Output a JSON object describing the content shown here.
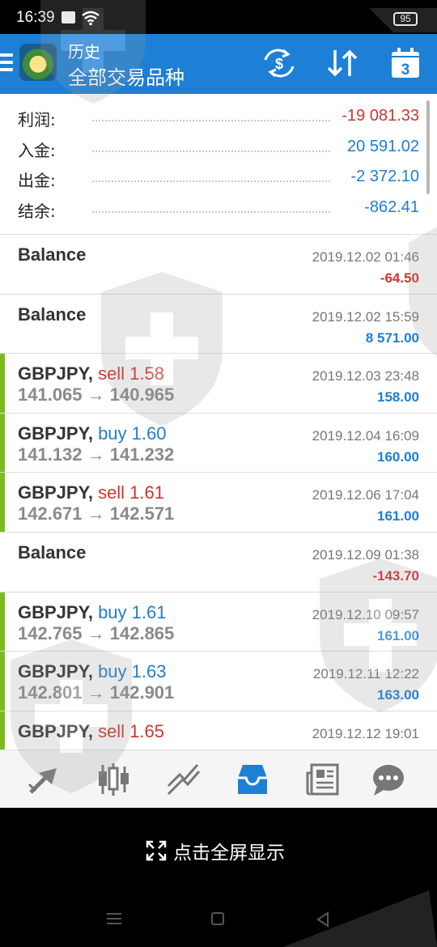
{
  "status_bar": {
    "time": "16:39",
    "battery": "95"
  },
  "header": {
    "subtitle": "历史",
    "title": "全部交易品种"
  },
  "header_icons": [
    "exchange-icon",
    "sort-icon",
    "calendar-icon"
  ],
  "calendar_day": "3",
  "summary": [
    {
      "label": "利润:",
      "value": "-19 081.33",
      "color": "red"
    },
    {
      "label": "入金:",
      "value": "20 591.02",
      "color": "blue"
    },
    {
      "label": "出金:",
      "value": "-2 372.10",
      "color": "blue"
    },
    {
      "label": "结余:",
      "value": "-862.41",
      "color": "blue"
    }
  ],
  "deals": [
    {
      "type": "balance",
      "symbol": "Balance",
      "date": "2019.12.02 01:46",
      "profit": "-64.50",
      "profit_color": "red"
    },
    {
      "type": "balance",
      "symbol": "Balance",
      "date": "2019.12.02 15:59",
      "profit": "8 571.00",
      "profit_color": "blue"
    },
    {
      "type": "trade",
      "symbol": "GBPJPY,",
      "side": "sell 1.58",
      "side_color": "red",
      "prices": "141.065 → 140.965",
      "date": "2019.12.03 23:48",
      "profit": "158.00",
      "profit_color": "blue"
    },
    {
      "type": "trade",
      "symbol": "GBPJPY,",
      "side": "buy 1.60",
      "side_color": "blue",
      "prices": "141.132 → 141.232",
      "date": "2019.12.04 16:09",
      "profit": "160.00",
      "profit_color": "blue"
    },
    {
      "type": "trade",
      "symbol": "GBPJPY,",
      "side": "sell 1.61",
      "side_color": "red",
      "prices": "142.671 → 142.571",
      "date": "2019.12.06 17:04",
      "profit": "161.00",
      "profit_color": "blue"
    },
    {
      "type": "balance",
      "symbol": "Balance",
      "date": "2019.12.09 01:38",
      "profit": "-143.70",
      "profit_color": "red"
    },
    {
      "type": "trade",
      "symbol": "GBPJPY,",
      "side": "buy 1.61",
      "side_color": "blue",
      "prices": "142.765 → 142.865",
      "date": "2019.12.10 09:57",
      "profit": "161.00",
      "profit_color": "blue"
    },
    {
      "type": "trade",
      "symbol": "GBPJPY,",
      "side": "buy 1.63",
      "side_color": "blue",
      "prices": "142.801 → 142.901",
      "date": "2019.12.11 12:22",
      "profit": "163.00",
      "profit_color": "blue"
    },
    {
      "type": "trade",
      "symbol": "GBPJPY,",
      "side": "sell 1.65",
      "side_color": "red",
      "prices": "",
      "date": "2019.12.12 19:01",
      "profit": "",
      "profit_color": "blue"
    }
  ],
  "bottom_nav": [
    "quotes-icon",
    "chart-icon",
    "trade-icon",
    "history-icon",
    "news-icon",
    "chat-icon"
  ],
  "active_nav": "history-icon",
  "fullscreen_hint": "点击全屏显示",
  "colors": {
    "primary": "#1d7fd6",
    "profit_red": "#d0342c",
    "profit_blue": "#1e7ed0",
    "trade_marker": "#7cbb1a"
  }
}
